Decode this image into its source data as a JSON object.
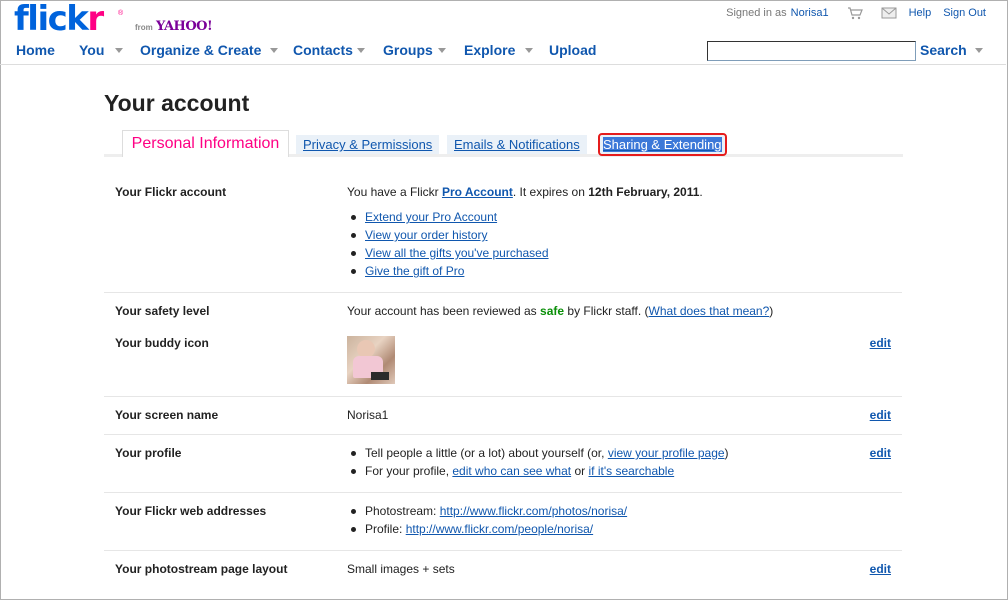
{
  "brand": {
    "flick": "flick",
    "r": "r",
    "reg": "®",
    "from": "from",
    "yahoo": "YAHOO!"
  },
  "topbar": {
    "signed_in_as": "Signed in as",
    "username": "Norisa1",
    "help": "Help",
    "sign_out": "Sign Out"
  },
  "nav": {
    "home": "Home",
    "you": "You",
    "organize": "Organize & Create",
    "contacts": "Contacts",
    "groups": "Groups",
    "explore": "Explore",
    "upload": "Upload",
    "search_button": "Search",
    "search_value": ""
  },
  "page": {
    "title": "Your account",
    "tabs": [
      {
        "label": "Personal Information"
      },
      {
        "label": "Privacy & Permissions"
      },
      {
        "label": "Emails & Notifications"
      },
      {
        "label": "Sharing & Extending"
      }
    ]
  },
  "rows": {
    "flickr_account": {
      "label": "Your Flickr account",
      "text_prefix": "You have a Flickr",
      "pro_link": "Pro Account",
      "text_mid": ". It expires on",
      "expiry": "12th February, 2011",
      "text_end": ".",
      "links": [
        "Extend your Pro Account",
        "View your order history",
        "View all the gifts you've purchased",
        "Give the gift of Pro"
      ]
    },
    "safety": {
      "label": "Your safety level",
      "text_prefix": "Your account has been reviewed as",
      "level": "safe",
      "text_mid": "by Flickr staff. (",
      "link": "What does that mean?",
      "text_end": ")"
    },
    "buddy_icon": {
      "label": "Your buddy icon",
      "edit": "edit"
    },
    "screen_name": {
      "label": "Your screen name",
      "value": "Norisa1",
      "edit": "edit"
    },
    "profile": {
      "label": "Your profile",
      "line1_prefix": "Tell people a little (or a lot) about yourself (or,",
      "line1_link": "view your profile page",
      "line1_end": ")",
      "line2_prefix": "For your profile,",
      "line2_link1": "edit who can see what",
      "line2_mid": "or",
      "line2_link2": "if it's searchable",
      "edit": "edit"
    },
    "web_addresses": {
      "label": "Your Flickr web addresses",
      "photostream_label": "Photostream:",
      "photostream_url": "http://www.flickr.com/photos/norisa/",
      "profile_label": "Profile:",
      "profile_url": "http://www.flickr.com/people/norisa/"
    },
    "layout": {
      "label": "Your photostream page layout",
      "value": "Small images + sets",
      "edit": "edit"
    }
  },
  "colors": {
    "brand_blue": "#0063dc",
    "brand_pink": "#ff0084",
    "link": "#1057ae",
    "safe_green": "#0a8f08",
    "highlight_red": "#e51c1c"
  }
}
